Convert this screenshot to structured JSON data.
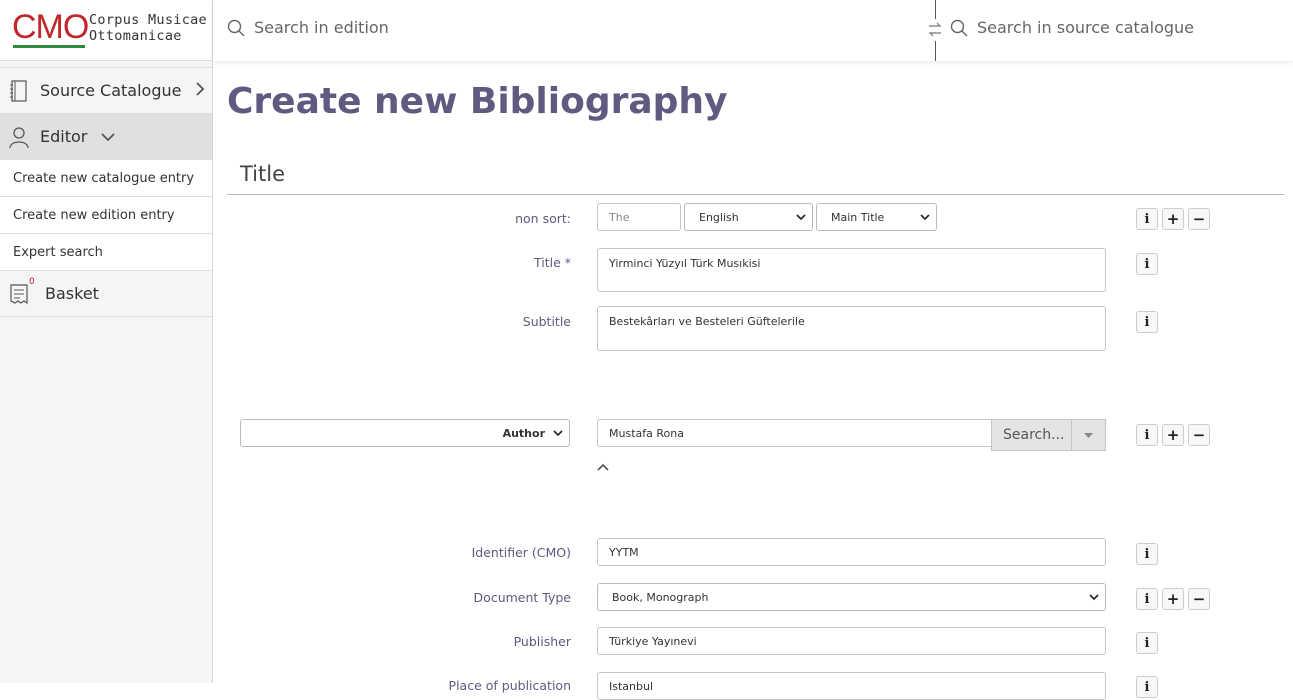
{
  "logo": {
    "mark": "CMO",
    "line1": "Corpus Musicae",
    "line2": "Ottomanicae"
  },
  "topbar": {
    "search_edition": "Search in edition",
    "search_source": "Search in source catalogue"
  },
  "sidebar": {
    "source_catalogue": "Source Catalogue",
    "editor": "Editor",
    "sub_items": [
      "Create new catalogue entry",
      "Create new edition entry",
      "Expert search"
    ],
    "basket": "Basket",
    "basket_count": "0"
  },
  "page": {
    "title": "Create new Bibliography",
    "section": "Title"
  },
  "form": {
    "non_sort_label": "non sort:",
    "non_sort_placeholder": "The",
    "language": "English",
    "title_type": "Main Title",
    "title_label": "Title *",
    "title_value": "Yirminci Yüzyıl Türk Musıkisi",
    "subtitle_label": "Subtitle",
    "subtitle_value": "Bestekârları ve Besteleri Güftelerile",
    "author_role": "Author",
    "author_value": "Mustafa Rona",
    "author_search": "Search...",
    "identifier_label": "Identifier (CMO)",
    "identifier_value": "YYTM",
    "doctype_label": "Document Type",
    "doctype_value": "Book, Monograph",
    "publisher_label": "Publisher",
    "publisher_value": "Türkiye Yayınevi",
    "place_label": "Place of publication",
    "place_value": "Istanbul"
  },
  "colors": {
    "accent": "#5e5a80",
    "logo_red": "#c0262c",
    "logo_green": "#2d8a3a"
  }
}
